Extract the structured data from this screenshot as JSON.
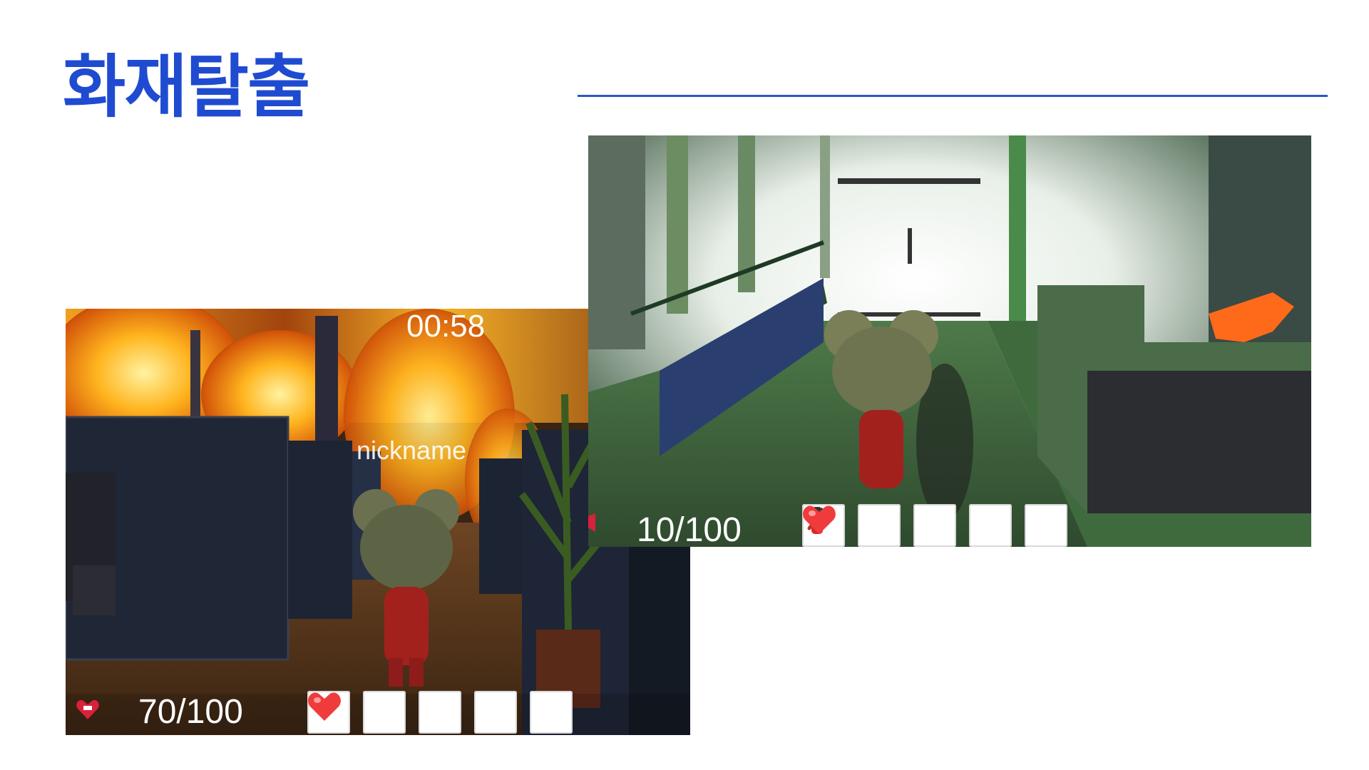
{
  "slide": {
    "title": "화재탈출",
    "accent_color": "#1f4bd1"
  },
  "screenshot_left": {
    "timer": "00:58",
    "nickname": "nickname",
    "health": "70/100",
    "inventory": [
      {
        "slot": 1,
        "icon": "empty"
      },
      {
        "slot": 2,
        "icon": "empty"
      },
      {
        "slot": 3,
        "icon": "empty"
      },
      {
        "slot": 4,
        "icon": "heart-icon"
      },
      {
        "slot": 5,
        "icon": "empty"
      }
    ]
  },
  "screenshot_right": {
    "health": "10/100",
    "inventory": [
      {
        "slot": 1,
        "icon": "axe-icon"
      },
      {
        "slot": 2,
        "icon": "fire-extinguisher-icon"
      },
      {
        "slot": 3,
        "icon": "empty"
      },
      {
        "slot": 4,
        "icon": "heart-icon"
      },
      {
        "slot": 5,
        "icon": "empty"
      }
    ]
  }
}
